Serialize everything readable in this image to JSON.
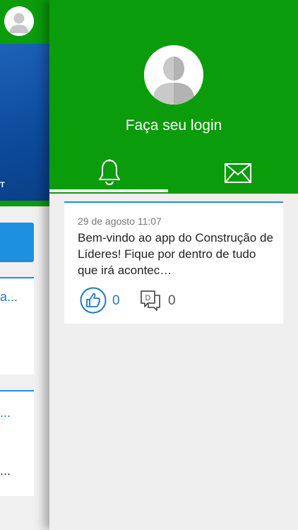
{
  "background": {
    "banner_text": "T",
    "ellipsis_1": "a...",
    "ellipsis_2": "...",
    "ellipsis_3": "..."
  },
  "drawer": {
    "login_label": "Faça seu login",
    "tabs": [
      {
        "name": "notifications",
        "icon": "bell-icon"
      },
      {
        "name": "messages",
        "icon": "envelope-icon"
      }
    ],
    "card": {
      "date": "29 de agosto 11:07",
      "text": "Bem-vindo ao app do Construção de Líderes! Fique por dentro de tudo que irá acontec…",
      "likes": "0",
      "comments": "0"
    }
  },
  "colors": {
    "green": "#0a9c0a",
    "blue": "#1e90e0",
    "banner_blue": "#0c4a9a"
  }
}
